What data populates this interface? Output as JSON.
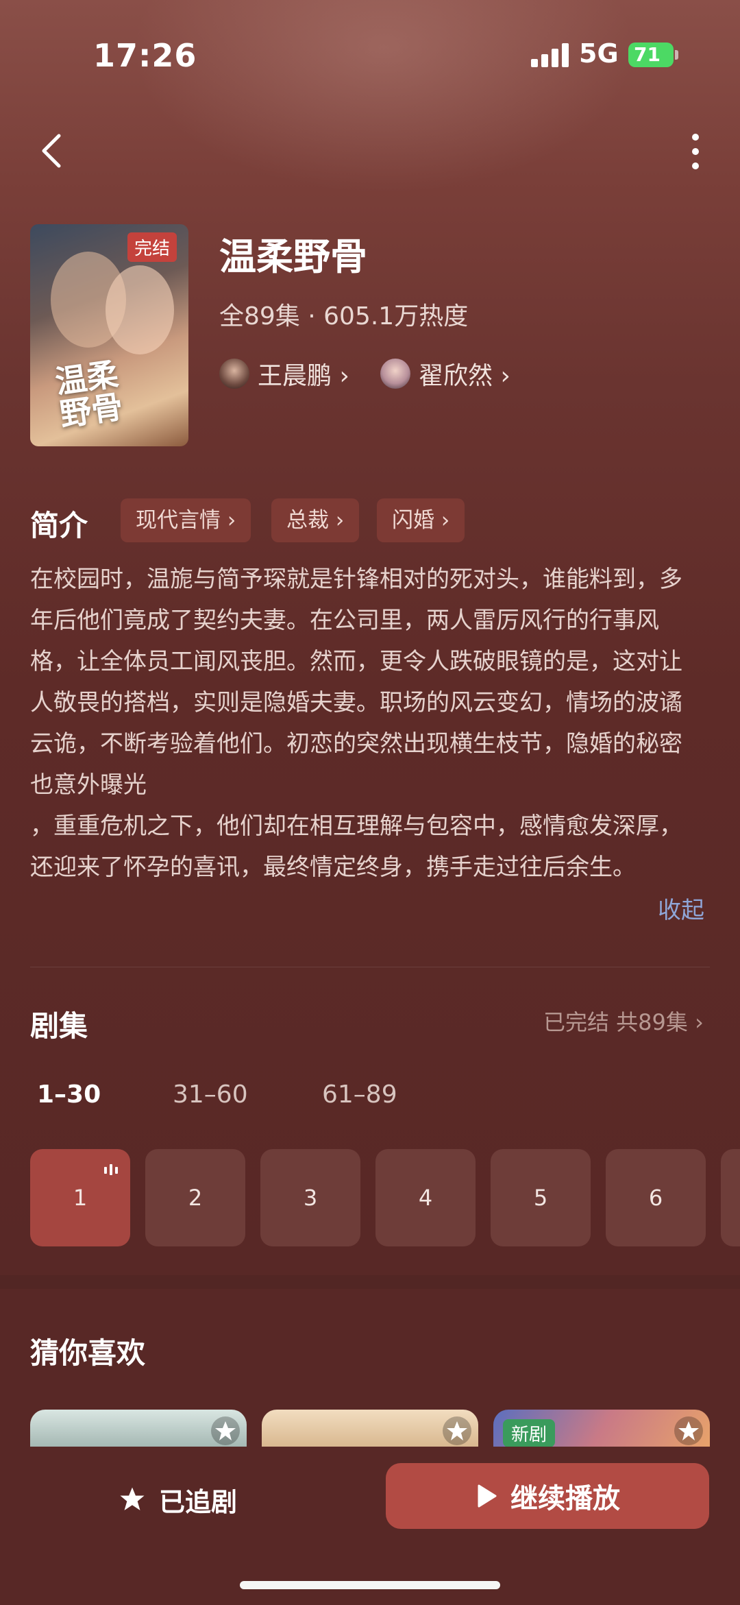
{
  "status_bar": {
    "time": "17:26",
    "network": "5G",
    "battery": "71"
  },
  "drama": {
    "status_badge": "完结",
    "poster_title": "温柔\n野骨",
    "title": "温柔野骨",
    "meta": "全89集 · 605.1万热度",
    "cast": [
      {
        "name": "王晨鹏 ›"
      },
      {
        "name": "翟欣然 ›"
      }
    ]
  },
  "intro": {
    "heading": "简介",
    "tags": [
      "现代言情 ›",
      "总裁 ›",
      "闪婚 ›"
    ],
    "description": "在校园时，温旎与简予琛就是针锋相对的死对头，谁能料到，多年后他们竟成了契约夫妻。在公司里，两人雷厉风行的行事风格，让全体员工闻风丧胆。然而，更令人跌破眼镜的是，这对让人敬畏的搭档，实则是隐婚夫妻。职场的风云变幻，情场的波谲云诡，不断考验着他们。初恋的突然出现横生枝节，隐婚的秘密也意外曝光\n，重重危机之下，他们却在相互理解与包容中，感情愈发深厚，还迎来了怀孕的喜讯，最终情定终身，携手走过往后余生。",
    "collapse": "收起"
  },
  "episodes": {
    "heading": "剧集",
    "status": "已完结 共89集 ›",
    "ranges": [
      "1–30",
      "31–60",
      "61–89"
    ],
    "active_range": 0,
    "items": [
      "1",
      "2",
      "3",
      "4",
      "5",
      "6"
    ],
    "playing_episode": "1"
  },
  "recommend": {
    "heading": "猜你喜欢",
    "new_badge": "新剧"
  },
  "bottom": {
    "follow_label": "已追剧",
    "play_label": "继续播放"
  },
  "colors": {
    "accent": "#b24b44",
    "background": "#582826",
    "link": "#8fa6d8"
  }
}
